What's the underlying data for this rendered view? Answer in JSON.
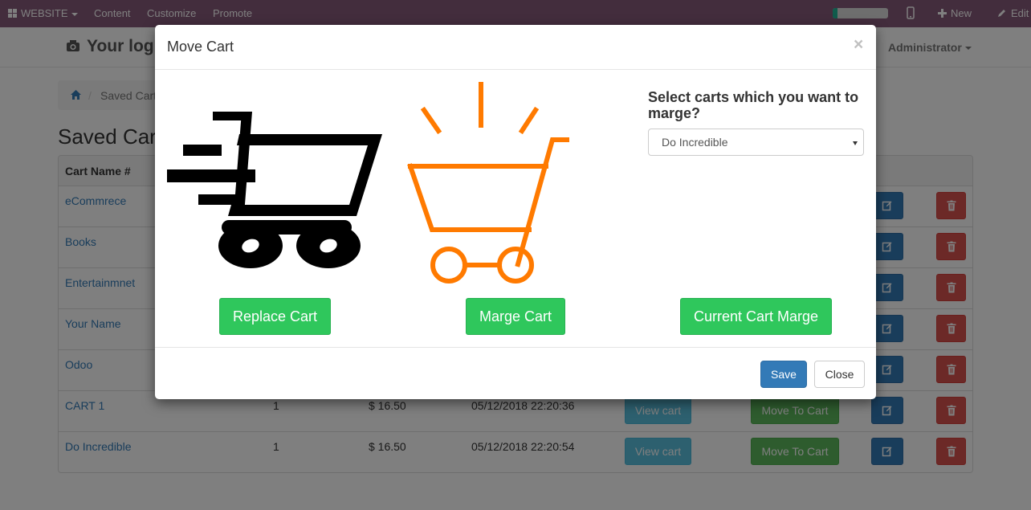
{
  "topbar": {
    "website_label": "WEBSITE",
    "menu": [
      "Content",
      "Customize",
      "Promote"
    ],
    "new_label": "New",
    "edit_label": "Edit",
    "progress": 0.08
  },
  "header": {
    "logo_text": "Your log",
    "user": "Administrator"
  },
  "breadcrumb": {
    "current": "Saved Cart"
  },
  "page_title": "Saved Cart",
  "table": {
    "header_first_col": "Cart Name #",
    "rows": [
      {
        "name": "eCommrece"
      },
      {
        "name": "Books"
      },
      {
        "name": "Entertainmnet"
      },
      {
        "name": "Your Name"
      },
      {
        "name": "Odoo"
      },
      {
        "name": "CART 1",
        "qty": "1",
        "price": "$ 16.50",
        "date": "05/12/2018 22:20:36",
        "view": "View cart",
        "move": "Move To Cart"
      },
      {
        "name": "Do Incredible",
        "qty": "1",
        "price": "$ 16.50",
        "date": "05/12/2018 22:20:54",
        "view": "View cart",
        "move": "Move To Cart"
      }
    ]
  },
  "modal": {
    "title": "Move Cart",
    "close_symbol": "×",
    "question": "Select carts which you want to marge?",
    "select_value": "Do Incredible",
    "replace_label": "Replace Cart",
    "marge_label": "Marge Cart",
    "current_marge_label": "Current Cart Marge",
    "save_label": "Save",
    "close_label": "Close"
  },
  "colors": {
    "topbar": "#875a7b",
    "green_button": "#2fc75c",
    "primary": "#337ab7",
    "danger": "#d9534f",
    "orange_cart": "#ff7a00"
  }
}
